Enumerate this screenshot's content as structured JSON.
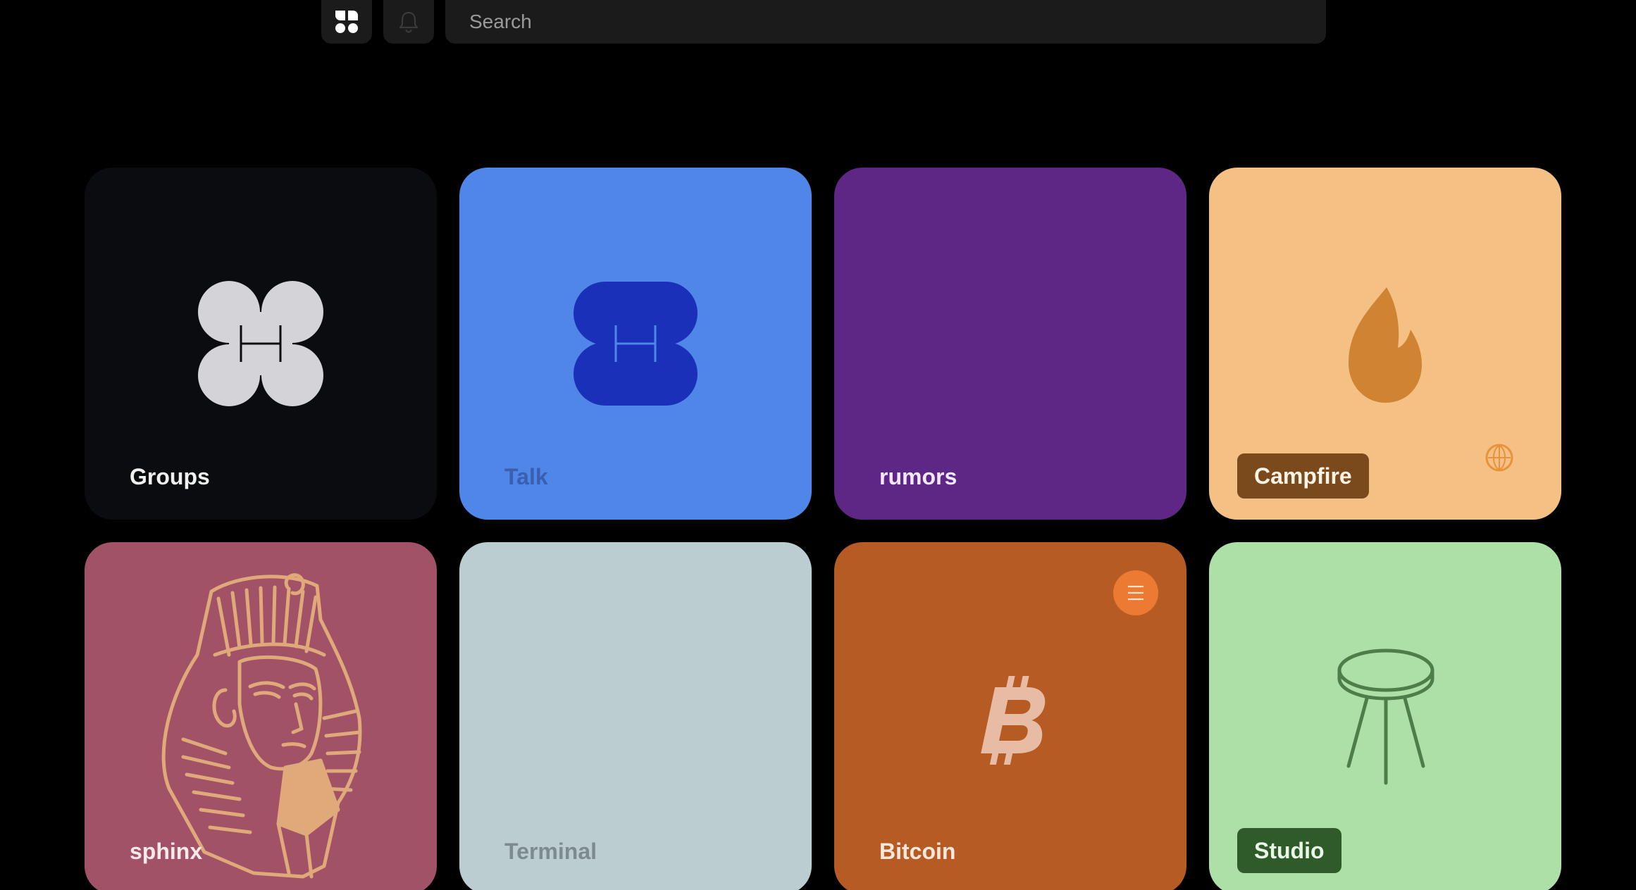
{
  "search": {
    "placeholder": "Search"
  },
  "topbar": {
    "apps_icon": "apps-grid-icon",
    "notifications_icon": "bell-icon"
  },
  "tiles": [
    {
      "label": "Groups",
      "bg": "#0b0c0f",
      "label_color": "#f0f0f0",
      "icon": "clover-logo-icon"
    },
    {
      "label": "Talk",
      "bg": "#4f86e8",
      "label_color": "#3a5fb0",
      "icon": "talk-logo-icon"
    },
    {
      "label": "rumors",
      "bg": "#5e2785",
      "label_color": "#f2e8fb",
      "icon": ""
    },
    {
      "label": "Campfire",
      "bg": "#f5c083",
      "label_color": "#fff3e6",
      "pill": "#7a4a1c",
      "icon": "flame-icon",
      "badge_icon": "globe-badge-icon"
    },
    {
      "label": "sphinx",
      "bg": "#a15266",
      "label_color": "#fbe9ee",
      "icon": "sphinx-illustration"
    },
    {
      "label": "Terminal",
      "bg": "#bccdd2",
      "label_color": "#7d8b90",
      "icon": ""
    },
    {
      "label": "Bitcoin",
      "bg": "#b65b24",
      "label_color": "#fbe8dc",
      "icon": "bitcoin-icon",
      "badge_icon": "menu-badge-icon"
    },
    {
      "label": "Studio",
      "bg": "#ade0a7",
      "label_color": "#e9f7e6",
      "pill": "#2f5a2a",
      "icon": "stool-icon"
    }
  ]
}
